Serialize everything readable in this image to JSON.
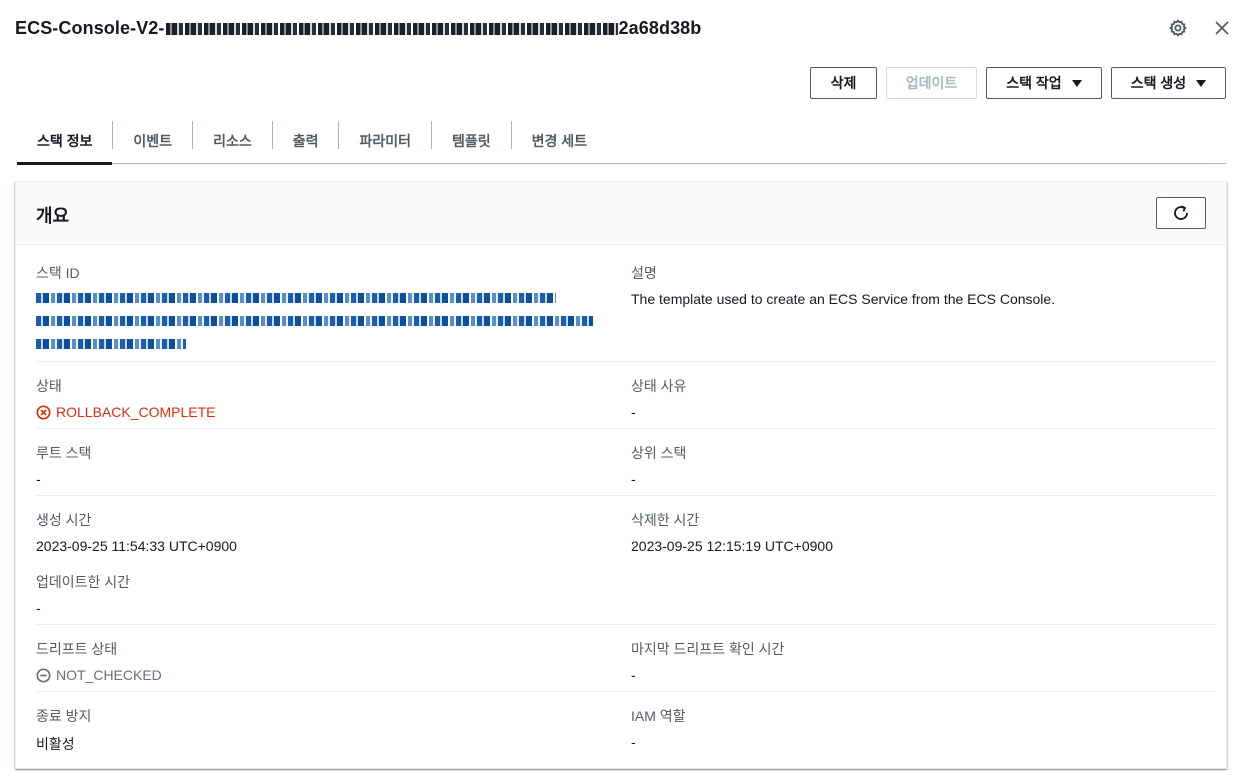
{
  "header": {
    "title_prefix": "ECS-Console-V2-",
    "title_suffix": "2a68d38b",
    "settings_icon": "gear-icon",
    "close_icon": "close-icon"
  },
  "actions": {
    "delete": "삭제",
    "update": "업데이트",
    "stack_actions": "스택 작업",
    "create_stack": "스택 생성"
  },
  "tabs": [
    "스택 정보",
    "이벤트",
    "리소스",
    "출력",
    "파라미터",
    "템플릿",
    "변경 세트"
  ],
  "overview": {
    "title": "개요",
    "refresh_icon": "refresh-icon",
    "stack_id_label": "스택 ID",
    "description_label": "설명",
    "description_value": "The template used to create an ECS Service from the ECS Console.",
    "status_label": "상태",
    "status_value": "ROLLBACK_COMPLETE",
    "status_reason_label": "상태 사유",
    "status_reason_value": "-",
    "root_stack_label": "루트 스택",
    "root_stack_value": "-",
    "parent_stack_label": "상위 스택",
    "parent_stack_value": "-",
    "created_label": "생성 시간",
    "created_value": "2023-09-25 11:54:33 UTC+0900",
    "deleted_label": "삭제한 시간",
    "deleted_value": "2023-09-25 12:15:19 UTC+0900",
    "updated_label": "업데이트한 시간",
    "updated_value": "-",
    "drift_label": "드리프트 상태",
    "drift_value": "NOT_CHECKED",
    "last_drift_label": "마지막 드리프트 확인 시간",
    "last_drift_value": "-",
    "termination_label": "종료 방지",
    "termination_value": "비활성",
    "iam_role_label": "IAM 역할",
    "iam_role_value": "-"
  },
  "colors": {
    "error_red": "#d13212",
    "text_dark": "#16191f",
    "text_gray": "#545b64"
  }
}
